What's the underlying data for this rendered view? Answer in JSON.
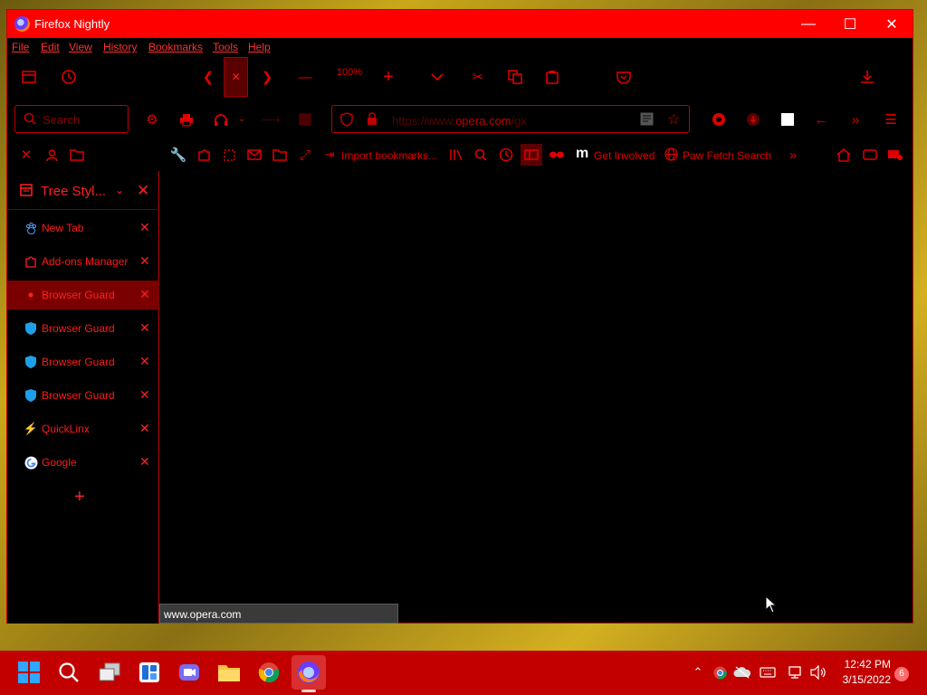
{
  "window": {
    "title": "Firefox Nightly"
  },
  "menu": [
    "File",
    "Edit",
    "View",
    "History",
    "Bookmarks",
    "Tools",
    "Help"
  ],
  "toolbar": {
    "zoom": "100%",
    "search_placeholder": "Search",
    "url_prefix": "https://www.",
    "url_host": "opera.com",
    "url_rest": "/gx"
  },
  "bookmarks": {
    "import": "Import bookmarks...",
    "m_logo": "m",
    "involved": "Get Involved",
    "paw": "Paw Fetch Search"
  },
  "sidebar": {
    "title": "Tree Styl...",
    "tabs": [
      {
        "label": "New Tab",
        "icon": "paw-icon"
      },
      {
        "label": "Add-ons Manager",
        "icon": "puzzle-icon"
      },
      {
        "label": "Browser Guard",
        "icon": "dot-icon",
        "selected": true
      },
      {
        "label": "Browser Guard",
        "icon": "shield-icon"
      },
      {
        "label": "Browser Guard",
        "icon": "shield-icon"
      },
      {
        "label": "Browser Guard",
        "icon": "shield-icon"
      },
      {
        "label": "QuickLinx",
        "icon": "bolt-icon"
      },
      {
        "label": "Google",
        "icon": "google-icon"
      }
    ]
  },
  "status": {
    "url": "www.opera.com"
  },
  "taskbar": {
    "time": "12:42 PM",
    "date": "3/15/2022",
    "notifications": "6"
  },
  "colors": {
    "accent": "#ff0000",
    "menu_text": "#ff3030",
    "taskbar": "#c20000"
  }
}
